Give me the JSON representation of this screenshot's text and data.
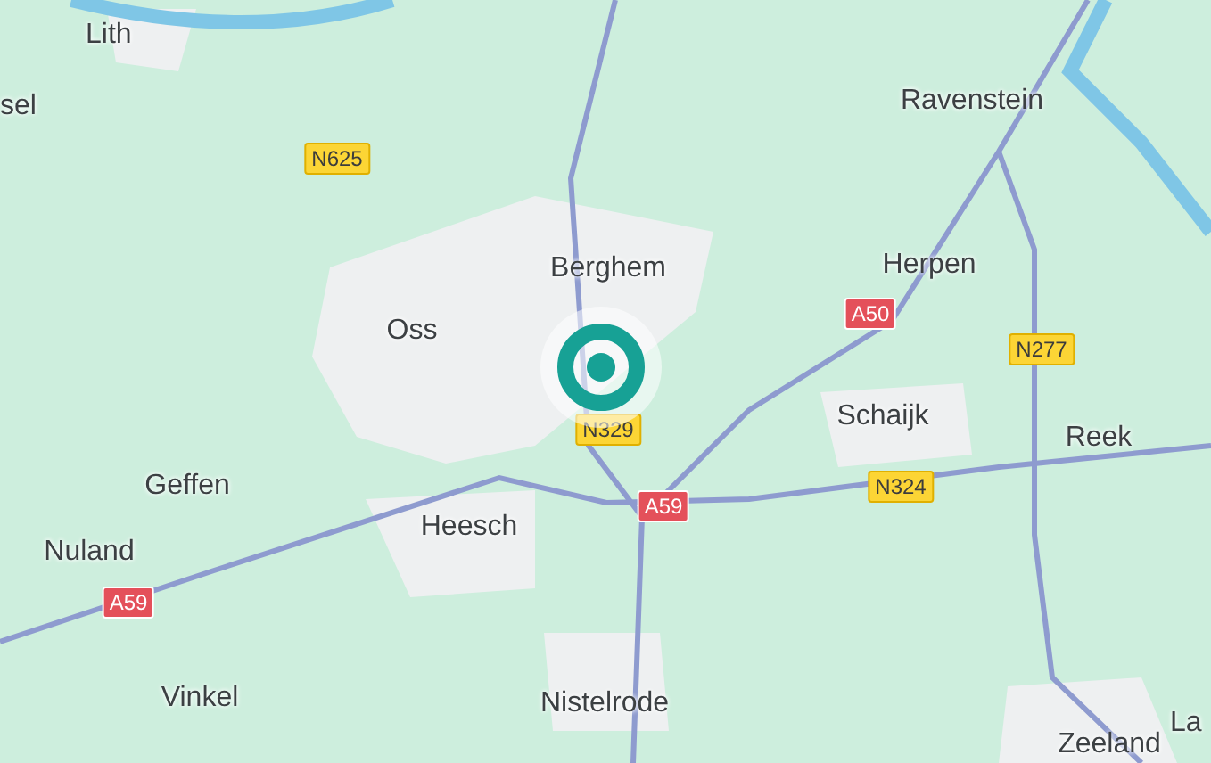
{
  "places": [
    {
      "name": "Lith"
    },
    {
      "name": "sel"
    },
    {
      "name": "Ravenstein"
    },
    {
      "name": "Berghem"
    },
    {
      "name": "Oss"
    },
    {
      "name": "Herpen"
    },
    {
      "name": "Schaijk"
    },
    {
      "name": "Reek"
    },
    {
      "name": "Geffen"
    },
    {
      "name": "Heesch"
    },
    {
      "name": "Nuland"
    },
    {
      "name": "Vinkel"
    },
    {
      "name": "Nistelrode"
    },
    {
      "name": "Zeeland"
    },
    {
      "name": "La"
    }
  ],
  "road_shields": [
    {
      "label": "N625",
      "kind": "provincial"
    },
    {
      "label": "A50",
      "kind": "motorway"
    },
    {
      "label": "N277",
      "kind": "provincial"
    },
    {
      "label": "N329",
      "kind": "provincial"
    },
    {
      "label": "N324",
      "kind": "provincial"
    },
    {
      "label": "A59",
      "kind": "motorway"
    },
    {
      "label": "A59",
      "kind": "motorway"
    }
  ],
  "marker": {
    "kind": "location"
  }
}
